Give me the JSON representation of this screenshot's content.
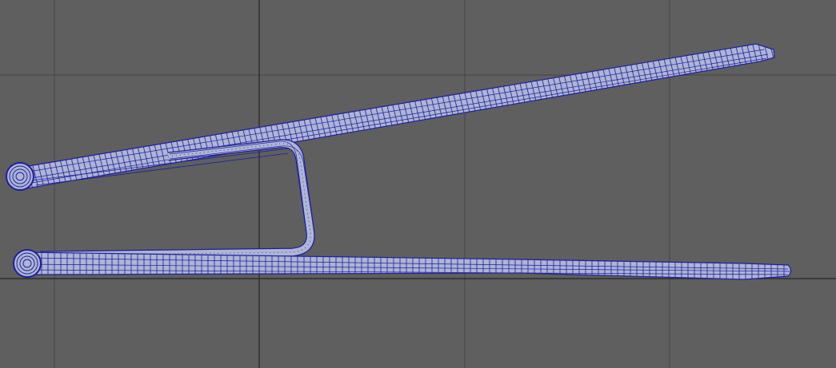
{
  "viewport": {
    "view": "side",
    "background_color": "#5f5f5f",
    "grid_color": "#3f3f3f",
    "axis_color": "#2f2f2f"
  },
  "model": {
    "name": "",
    "display": "wireframe-on-shaded",
    "wire_color": "#1f1f9a",
    "shade_color": "#aeb5d5",
    "parts": [
      {
        "id": "upper-arm",
        "label": ""
      },
      {
        "id": "u-bend-connector",
        "label": ""
      },
      {
        "id": "lower-arm",
        "label": ""
      },
      {
        "id": "upper-eye-loop",
        "label": ""
      },
      {
        "id": "lower-eye-loop",
        "label": ""
      }
    ]
  }
}
